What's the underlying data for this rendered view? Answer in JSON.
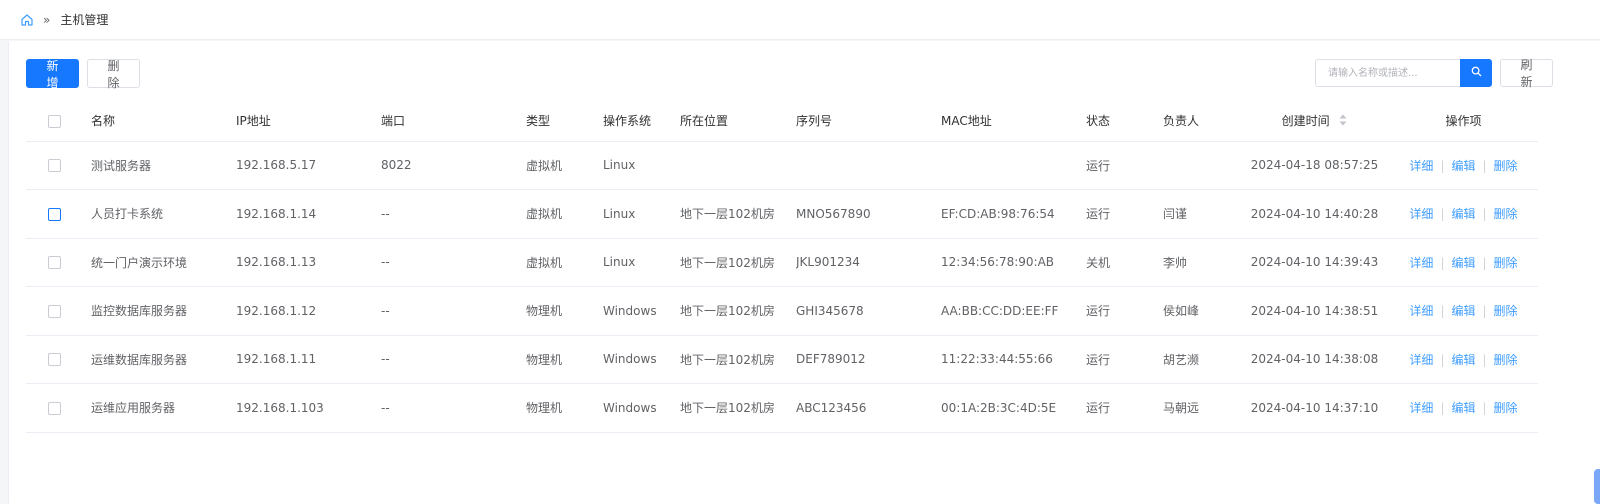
{
  "breadcrumb": {
    "separator": "»",
    "current": "主机管理"
  },
  "toolbar": {
    "add_label": "新增",
    "delete_label": "删除"
  },
  "search": {
    "placeholder": "请输入名称或描述...",
    "refresh_label": "刷新"
  },
  "table": {
    "headers": {
      "name": "名称",
      "ip": "IP地址",
      "port": "端口",
      "type": "类型",
      "os": "操作系统",
      "location": "所在位置",
      "serial": "序列号",
      "mac": "MAC地址",
      "status": "状态",
      "owner": "负责人",
      "created": "创建时间",
      "actions": "操作项"
    },
    "action_labels": {
      "detail": "详细",
      "edit": "编辑",
      "delete": "删除"
    },
    "rows": [
      {
        "name": "测试服务器",
        "ip": "192.168.5.17",
        "port": "8022",
        "type": "虚拟机",
        "os": "Linux",
        "location": "",
        "serial": "",
        "mac": "",
        "status": "运行",
        "owner": "",
        "created": "2024-04-18 08:57:25"
      },
      {
        "name": "人员打卡系统",
        "ip": "192.168.1.14",
        "port": "--",
        "type": "虚拟机",
        "os": "Linux",
        "location": "地下一层102机房",
        "serial": "MNO567890",
        "mac": "EF:CD:AB:98:76:54",
        "status": "运行",
        "owner": "闫谨",
        "created": "2024-04-10 14:40:28"
      },
      {
        "name": "统一门户演示环境",
        "ip": "192.168.1.13",
        "port": "--",
        "type": "虚拟机",
        "os": "Linux",
        "location": "地下一层102机房",
        "serial": "JKL901234",
        "mac": "12:34:56:78:90:AB",
        "status": "关机",
        "owner": "李帅",
        "created": "2024-04-10 14:39:43"
      },
      {
        "name": "监控数据库服务器",
        "ip": "192.168.1.12",
        "port": "--",
        "type": "物理机",
        "os": "Windows",
        "location": "地下一层102机房",
        "serial": "GHI345678",
        "mac": "AA:BB:CC:DD:EE:FF",
        "status": "运行",
        "owner": "侯如峰",
        "created": "2024-04-10 14:38:51"
      },
      {
        "name": "运维数据库服务器",
        "ip": "192.168.1.11",
        "port": "--",
        "type": "物理机",
        "os": "Windows",
        "location": "地下一层102机房",
        "serial": "DEF789012",
        "mac": "11:22:33:44:55:66",
        "status": "运行",
        "owner": "胡艺濒",
        "created": "2024-04-10 14:38:08"
      },
      {
        "name": "运维应用服务器",
        "ip": "192.168.1.103",
        "port": "--",
        "type": "物理机",
        "os": "Windows",
        "location": "地下一层102机房",
        "serial": "ABC123456",
        "mac": "00:1A:2B:3C:4D:5E",
        "status": "运行",
        "owner": "马朝远",
        "created": "2024-04-10 14:37:10"
      }
    ]
  },
  "colors": {
    "primary": "#1677ff",
    "link": "#409eff",
    "green": "#1aa34a",
    "danger": "#f02b2b"
  }
}
